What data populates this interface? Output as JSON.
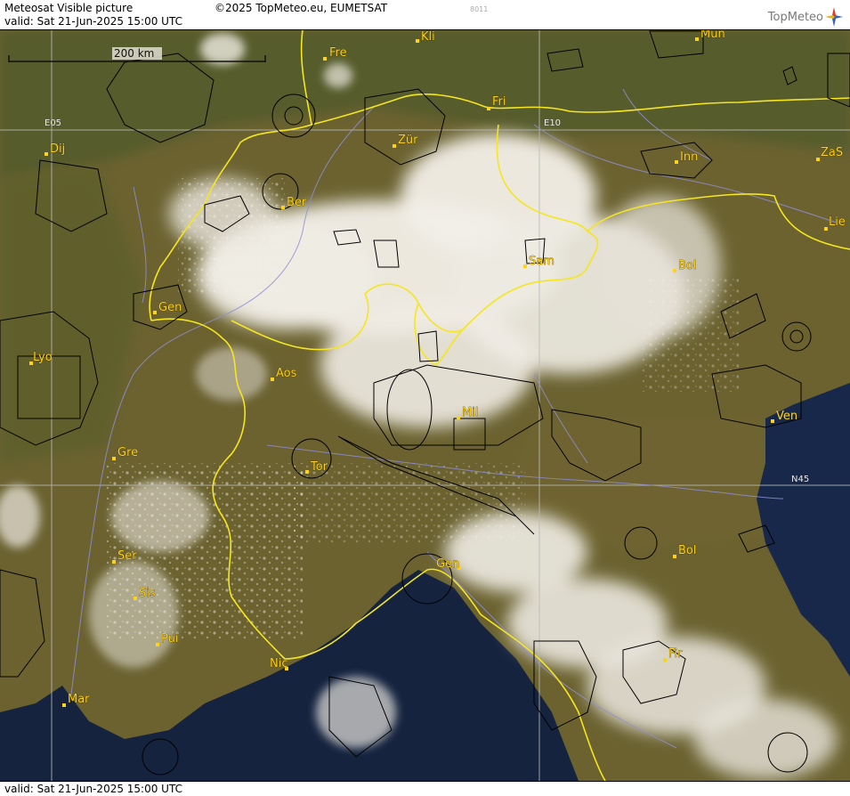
{
  "header": {
    "title": "Meteosat Visible picture",
    "copyright": "©2025 TopMeteo.eu, EUMETSAT",
    "code": "8011",
    "valid": "valid:  Sat  21-Jun-2025  15:00 UTC",
    "logo_text": "TopMeteo"
  },
  "footer": {
    "valid": "valid:  Sat  21-Jun-2025  15:00 UTC"
  },
  "map": {
    "scale_bar": "200 km",
    "grid_labels": [
      "E05",
      "E10",
      "N45"
    ],
    "cities": [
      {
        "id": "kli",
        "label": "Kli"
      },
      {
        "id": "mun",
        "label": "Mun"
      },
      {
        "id": "fre",
        "label": "Fre"
      },
      {
        "id": "fri",
        "label": "Fri"
      },
      {
        "id": "dij",
        "label": "Dij"
      },
      {
        "id": "zur",
        "label": "Zür"
      },
      {
        "id": "inn",
        "label": "Inn"
      },
      {
        "id": "zas",
        "label": "ZaS"
      },
      {
        "id": "ber",
        "label": "Ber"
      },
      {
        "id": "lie",
        "label": "Lie"
      },
      {
        "id": "sam",
        "label": "Sam"
      },
      {
        "id": "bol1",
        "label": "Bol"
      },
      {
        "id": "gen1",
        "label": "Gen"
      },
      {
        "id": "lyo",
        "label": "Lyo"
      },
      {
        "id": "aos",
        "label": "Aos"
      },
      {
        "id": "mil",
        "label": "Mil"
      },
      {
        "id": "ven",
        "label": "Ven"
      },
      {
        "id": "gre",
        "label": "Gre"
      },
      {
        "id": "tor",
        "label": "Tor"
      },
      {
        "id": "ser",
        "label": "Ser"
      },
      {
        "id": "gen2",
        "label": "Gen"
      },
      {
        "id": "bol2",
        "label": "Bol"
      },
      {
        "id": "sis",
        "label": "Sis"
      },
      {
        "id": "pui",
        "label": "Pui"
      },
      {
        "id": "fir",
        "label": "Fir"
      },
      {
        "id": "nic",
        "label": "Nic"
      },
      {
        "id": "mar",
        "label": "Mar"
      }
    ],
    "colors": {
      "land": "#6b6230",
      "land_green": "#4f5a2c",
      "sea": "#15233f",
      "cloud": "#f2efe8",
      "border": "#f5e61e",
      "city": "#ffd21a",
      "airspace": "#000000",
      "river": "#8f8fd6",
      "grid": "#b9b9b9"
    }
  }
}
